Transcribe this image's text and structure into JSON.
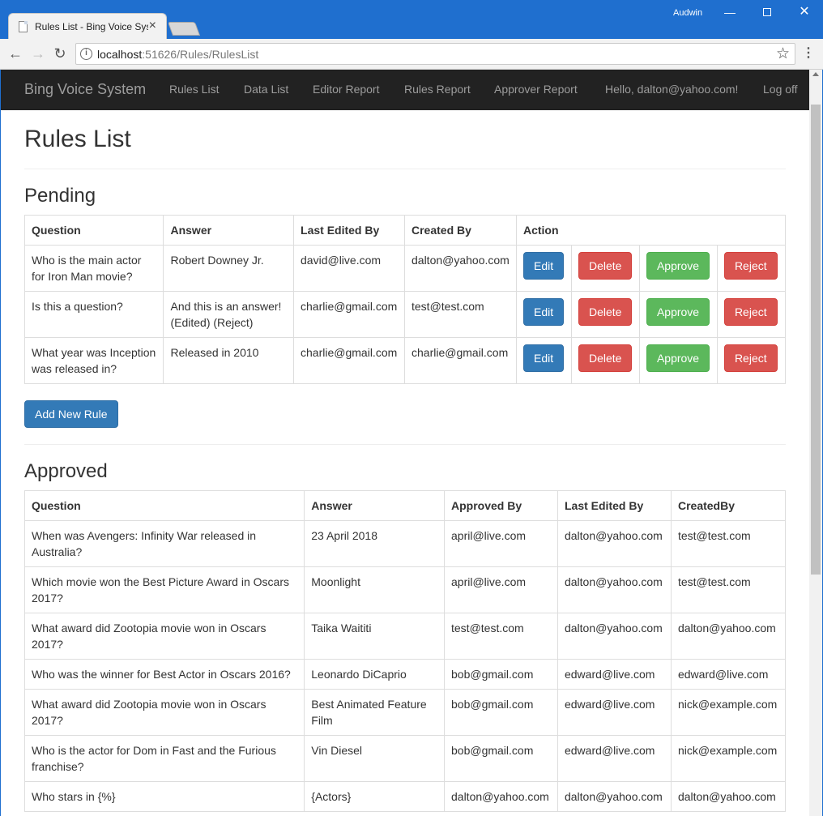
{
  "browser": {
    "tab_title": "Rules List - Bing Voice System",
    "close_glyph": "×",
    "user": "Audwin",
    "url_host": "localhost",
    "url_rest": ":51626/Rules/RulesList"
  },
  "navbar": {
    "brand": "Bing Voice System",
    "links": [
      "Rules List",
      "Data List",
      "Editor Report",
      "Rules Report",
      "Approver Report"
    ],
    "greeting": "Hello, dalton@yahoo.com!",
    "logoff": "Log off"
  },
  "page": {
    "title": "Rules List",
    "add_button": "Add New Rule"
  },
  "pending": {
    "heading": "Pending",
    "headers": [
      "Question",
      "Answer",
      "Last Edited By",
      "Created By",
      "Action"
    ],
    "action_labels": {
      "edit": "Edit",
      "delete": "Delete",
      "approve": "Approve",
      "reject": "Reject"
    },
    "rows": [
      {
        "question": "Who is the main actor for Iron Man movie?",
        "answer": "Robert Downey Jr.",
        "last_edited_by": "david@live.com",
        "created_by": "dalton@yahoo.com"
      },
      {
        "question": "Is this a question?",
        "answer": "And this is an answer! (Edited) (Reject)",
        "last_edited_by": "charlie@gmail.com",
        "created_by": "test@test.com"
      },
      {
        "question": "What year was Inception was released in?",
        "answer": "Released in 2010",
        "last_edited_by": "charlie@gmail.com",
        "created_by": "charlie@gmail.com"
      }
    ]
  },
  "approved": {
    "heading": "Approved",
    "headers": [
      "Question",
      "Answer",
      "Approved By",
      "Last Edited By",
      "CreatedBy"
    ],
    "rows": [
      {
        "question": "When was Avengers: Infinity War released in Australia?",
        "answer": "23 April 2018",
        "approved_by": "april@live.com",
        "last_edited_by": "dalton@yahoo.com",
        "created_by": "test@test.com"
      },
      {
        "question": "Which movie won the Best Picture Award in Oscars 2017?",
        "answer": "Moonlight",
        "approved_by": "april@live.com",
        "last_edited_by": "dalton@yahoo.com",
        "created_by": "test@test.com"
      },
      {
        "question": "What award did Zootopia movie won in Oscars 2017?",
        "answer": "Taika Waititi",
        "approved_by": "test@test.com",
        "last_edited_by": "dalton@yahoo.com",
        "created_by": "dalton@yahoo.com"
      },
      {
        "question": "Who was the winner for Best Actor in Oscars 2016?",
        "answer": "Leonardo DiCaprio",
        "approved_by": "bob@gmail.com",
        "last_edited_by": "edward@live.com",
        "created_by": "edward@live.com"
      },
      {
        "question": "What award did Zootopia movie won in Oscars 2017?",
        "answer": "Best Animated Feature Film",
        "approved_by": "bob@gmail.com",
        "last_edited_by": "edward@live.com",
        "created_by": "nick@example.com"
      },
      {
        "question": "Who is the actor for Dom in Fast and the Furious franchise?",
        "answer": "Vin Diesel",
        "approved_by": "bob@gmail.com",
        "last_edited_by": "edward@live.com",
        "created_by": "nick@example.com"
      },
      {
        "question": "Who stars in {%}",
        "answer": "{Actors}",
        "approved_by": "dalton@yahoo.com",
        "last_edited_by": "dalton@yahoo.com",
        "created_by": "dalton@yahoo.com"
      }
    ]
  }
}
